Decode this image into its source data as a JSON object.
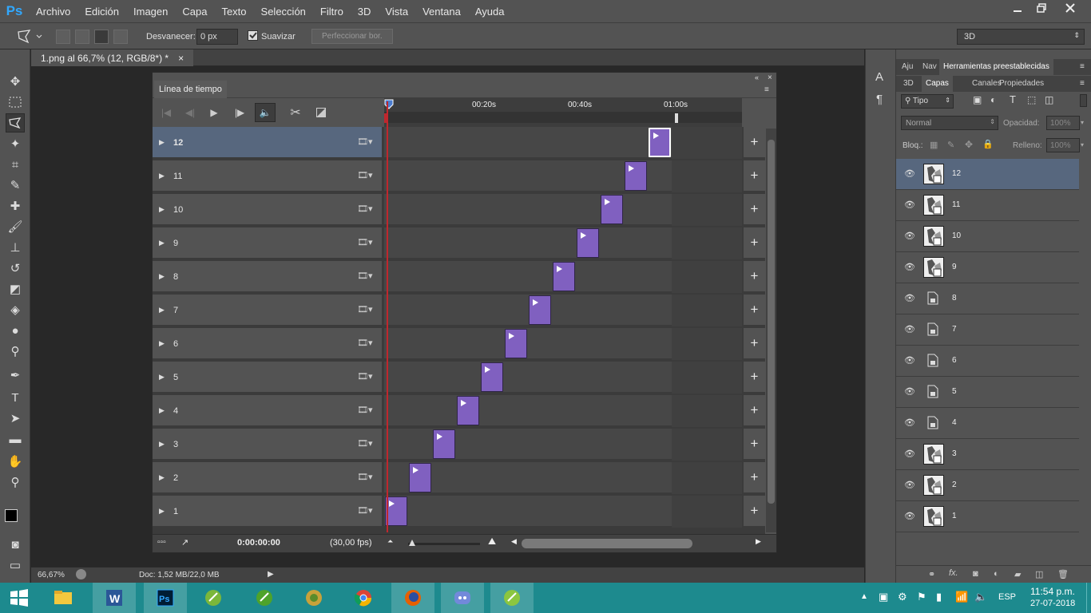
{
  "app": {
    "name": "Ps"
  },
  "menu": [
    "Archivo",
    "Edición",
    "Imagen",
    "Capa",
    "Texto",
    "Selección",
    "Filtro",
    "3D",
    "Vista",
    "Ventana",
    "Ayuda"
  ],
  "window_controls": [
    "minimize",
    "restore",
    "close"
  ],
  "options": {
    "feather_label": "Desvanecer:",
    "feather_value": "0 px",
    "antialias_label": "Suavizar",
    "refine_label": "Perfeccionar bor.",
    "workspace": "3D"
  },
  "document": {
    "tab_title": "1.png al 66,7% (12, RGB/8*) *",
    "close": "×"
  },
  "status": {
    "zoom": "66,67%",
    "doc": "Doc: 1,52 MB/22,0 MB"
  },
  "timeline": {
    "title": "Línea de tiempo",
    "ruler": [
      "00:20s",
      "00:40s",
      "01:00s"
    ],
    "tracks": [
      {
        "label": "12",
        "selected": true
      },
      {
        "label": "11"
      },
      {
        "label": "10"
      },
      {
        "label": "9"
      },
      {
        "label": "8"
      },
      {
        "label": "7"
      },
      {
        "label": "6"
      },
      {
        "label": "5"
      },
      {
        "label": "4"
      },
      {
        "label": "3"
      },
      {
        "label": "2"
      },
      {
        "label": "1"
      }
    ],
    "clip_starts_s": [
      55.5,
      50.5,
      45.5,
      40.5,
      35.5,
      30.5,
      25.5,
      20.5,
      15.5,
      10.5,
      5.5,
      0.5
    ],
    "timecode": "0:00:00:00",
    "fps": "(30,00 fps)"
  },
  "panels": {
    "top_tabs": [
      "Aju",
      "Nav",
      "Herramientas preestablecidas"
    ],
    "layer_tabs": [
      "3D",
      "Capas",
      "Canales",
      "Propiedades"
    ],
    "filter_kind": "Tipo",
    "blend_mode": "Normal",
    "opacity_label": "Opacidad:",
    "opacity_value": "100%",
    "lock_label": "Bloq.:",
    "fill_label": "Relleno:",
    "fill_value": "100%",
    "layers": [
      {
        "name": "12",
        "thumb": "image",
        "selected": true
      },
      {
        "name": "11",
        "thumb": "image"
      },
      {
        "name": "10",
        "thumb": "image"
      },
      {
        "name": "9",
        "thumb": "image"
      },
      {
        "name": "8",
        "thumb": "doc"
      },
      {
        "name": "7",
        "thumb": "doc"
      },
      {
        "name": "6",
        "thumb": "doc"
      },
      {
        "name": "5",
        "thumb": "doc"
      },
      {
        "name": "4",
        "thumb": "doc"
      },
      {
        "name": "3",
        "thumb": "image"
      },
      {
        "name": "2",
        "thumb": "image"
      },
      {
        "name": "1",
        "thumb": "image"
      }
    ]
  },
  "taskbar": {
    "apps": [
      "file-explorer",
      "word",
      "photoshop",
      "app-green-1",
      "app-green-2",
      "app-game",
      "chrome",
      "firefox",
      "discord",
      "app-green-3"
    ],
    "lang": "ESP",
    "time": "11:54 p.m.",
    "date": "27-07-2018"
  },
  "colors": {
    "accent": "#31a8ff",
    "clip": "#8060c0",
    "playhead": "#c0272d",
    "selected_row": "#57677e",
    "taskbar": "#1d8a8e"
  }
}
